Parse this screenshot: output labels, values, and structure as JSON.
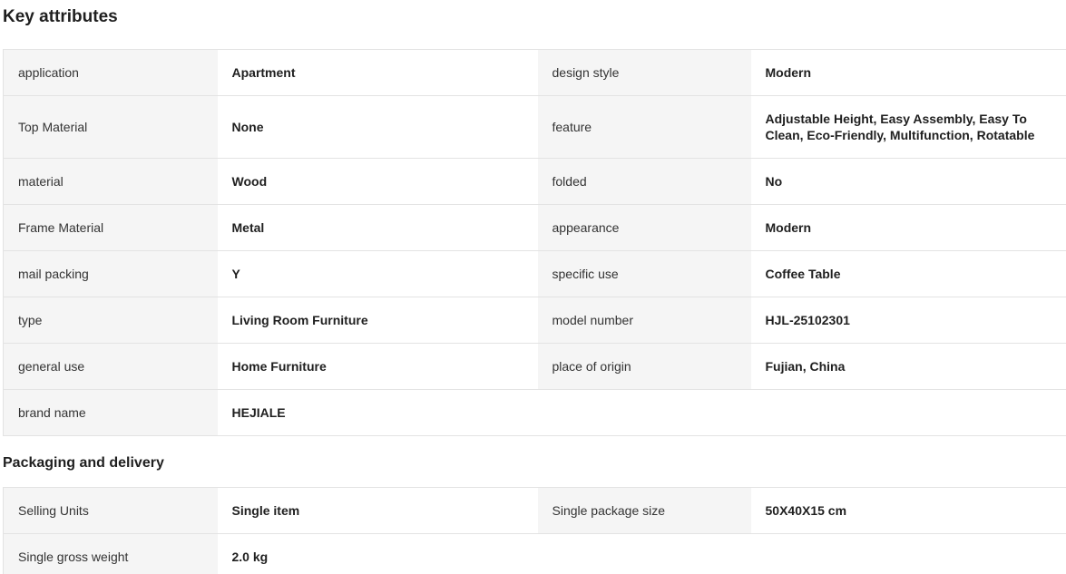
{
  "key_attributes": {
    "title": "Key attributes",
    "rows": [
      {
        "l1": "application",
        "v1": "Apartment",
        "l2": "design style",
        "v2": "Modern"
      },
      {
        "l1": "Top Material",
        "v1": "None",
        "l2": "feature",
        "v2": "Adjustable Height, Easy Assembly, Easy To Clean, Eco-Friendly, Multifunction, Rotatable"
      },
      {
        "l1": "material",
        "v1": "Wood",
        "l2": "folded",
        "v2": "No"
      },
      {
        "l1": "Frame Material",
        "v1": "Metal",
        "l2": "appearance",
        "v2": "Modern"
      },
      {
        "l1": "mail packing",
        "v1": "Y",
        "l2": "specific use",
        "v2": "Coffee Table"
      },
      {
        "l1": "type",
        "v1": "Living Room Furniture",
        "l2": "model number",
        "v2": "HJL-25102301"
      },
      {
        "l1": "general use",
        "v1": "Home Furniture",
        "l2": "place of origin",
        "v2": "Fujian, China"
      },
      {
        "l1": "brand name",
        "v1": "HEJIALE"
      }
    ]
  },
  "packaging": {
    "title": "Packaging and delivery",
    "rows": [
      {
        "l1": "Selling Units",
        "v1": "Single item",
        "l2": "Single package size",
        "v2": "50X40X15 cm"
      },
      {
        "l1": "Single gross weight",
        "v1": "2.0 kg"
      }
    ]
  }
}
